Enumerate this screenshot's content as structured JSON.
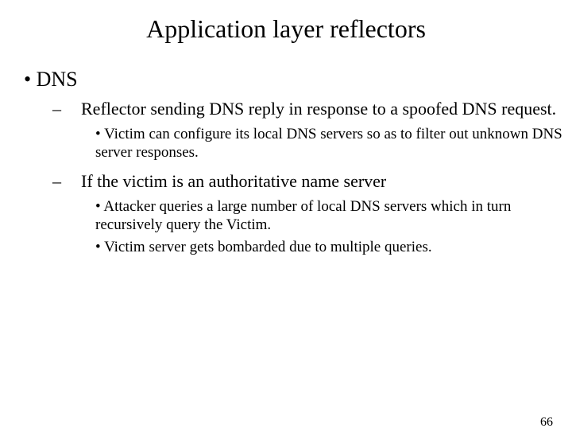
{
  "title": "Application layer reflectors",
  "bullets": {
    "l1": {
      "item1": "DNS"
    },
    "l2": {
      "item1": "Reflector sending DNS reply in response to a spoofed DNS request.",
      "item2": "If the victim is an authoritative name server"
    },
    "l3a": {
      "item1": "Victim can configure its local DNS servers so as to filter out unknown DNS server responses."
    },
    "l3b": {
      "item1": "Attacker queries a large number of local DNS servers which in turn recursively query the Victim.",
      "item2": "Victim server gets bombarded due to multiple queries."
    }
  },
  "page_number": "66"
}
